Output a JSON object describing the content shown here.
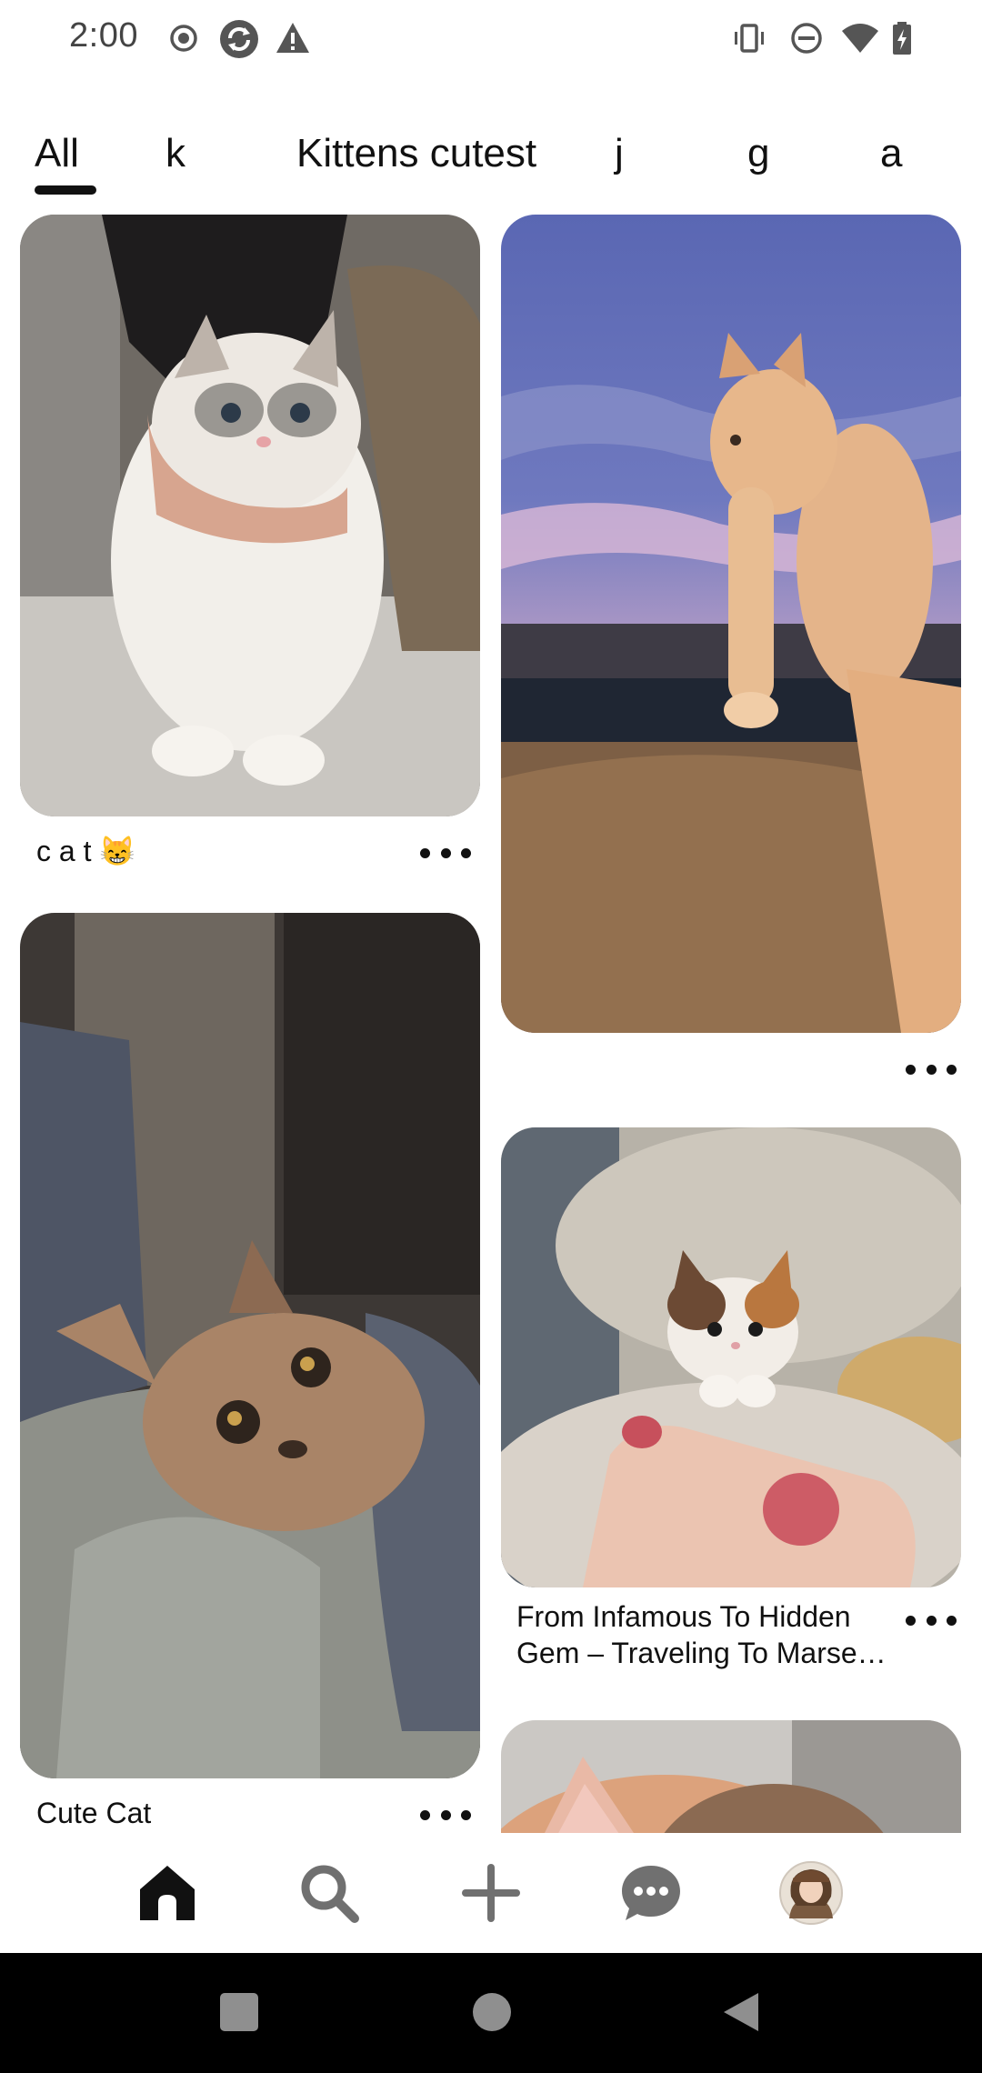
{
  "status_bar": {
    "time": "2:00",
    "left_icons": [
      "record-icon",
      "sync-app-icon",
      "warning-icon"
    ],
    "right_icons": [
      "vibrate-icon",
      "do-not-disturb-icon",
      "wifi-icon",
      "battery-charging-icon"
    ]
  },
  "tabs": [
    {
      "label": "All",
      "selected": true
    },
    {
      "label": "k",
      "selected": false
    },
    {
      "label": "Kittens cutest",
      "selected": false
    },
    {
      "label": "j",
      "selected": false
    },
    {
      "label": "g",
      "selected": false
    },
    {
      "label": "a",
      "selected": false
    }
  ],
  "pins": [
    {
      "id": "pin-white-cat",
      "caption": "c a t 😸",
      "more": "more-options-icon"
    },
    {
      "id": "pin-sunset-kitten",
      "caption": "",
      "more": "more-options-icon"
    },
    {
      "id": "pin-tabby-cat",
      "caption": "Cute Cat",
      "more": "more-options-icon"
    },
    {
      "id": "pin-tiny-kitten",
      "caption_lines": [
        "From Infamous To Hidden",
        "Gem – Traveling To Marse…"
      ],
      "more": "more-options-icon"
    },
    {
      "id": "pin-partial-cat",
      "caption": "",
      "more": ""
    }
  ],
  "bottom_nav": [
    {
      "name": "home",
      "icon": "home-icon",
      "active": true
    },
    {
      "name": "search",
      "icon": "search-icon",
      "active": false
    },
    {
      "name": "create",
      "icon": "plus-icon",
      "active": false
    },
    {
      "name": "messages",
      "icon": "chat-icon",
      "active": false
    },
    {
      "name": "profile",
      "icon": "avatar",
      "active": false
    }
  ],
  "system_nav": [
    "recents-button",
    "home-button",
    "back-button"
  ],
  "colors": {
    "text": "#111111",
    "icon_inactive": "#707070",
    "background": "#ffffff"
  }
}
